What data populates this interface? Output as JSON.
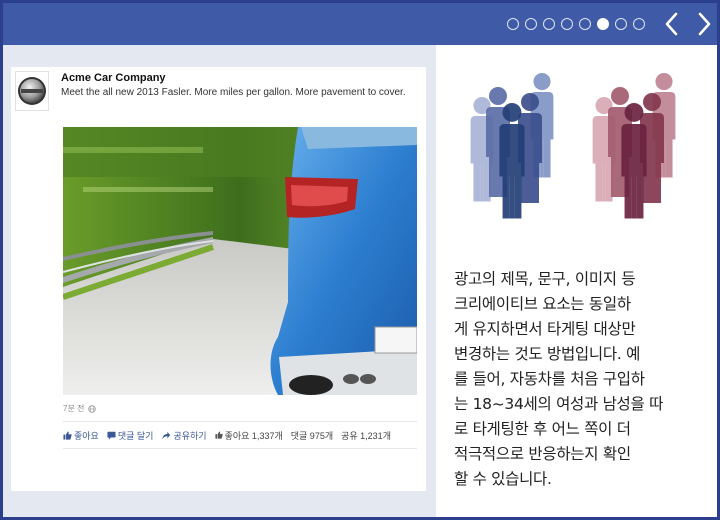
{
  "slider": {
    "total_slides": 8,
    "active_slide": 6,
    "prev_icon": "chevron-left-icon",
    "next_icon": "chevron-right-icon",
    "accent_color": "#3f5aa6"
  },
  "post": {
    "page_name": "Acme Car Company",
    "text": "Meet the all new 2013 Fasler. More miles per gallon. More pavement to cover.",
    "time": "7분 전",
    "actions": [
      {
        "label": "좋아요",
        "icon": "thumbs-up-icon"
      },
      {
        "label": "댓글 달기",
        "icon": "comment-icon"
      },
      {
        "label": "공유하기",
        "icon": "share-icon"
      }
    ],
    "stats": {
      "likes": "좋아요 1,337개",
      "comments": "댓글 975개",
      "shares": "공유 1,231개"
    }
  },
  "right": {
    "people_groups": [
      {
        "name": "blue-group",
        "colors": [
          "#a9b4d6",
          "#8194c4",
          "#5c6ea8",
          "#3c4f8f",
          "#233f78"
        ]
      },
      {
        "name": "red-group",
        "colors": [
          "#d8a9b4",
          "#c08493",
          "#a35c70",
          "#84384f",
          "#6b2340"
        ]
      }
    ],
    "text_lines": [
      "광고의 제목, 문구, 이미지 등",
      "크리에이티브 요소는 동일하",
      "게 유지하면서 타게팅 대상만",
      "변경하는 것도 방법입니다. 예",
      "를 들어, 자동차를 처음 구입하",
      "는 18~34세의 여성과 남성을 따",
      "로 타게팅한 후 어느 쪽이 더",
      "적극적으로 반응하는지 확인",
      "할 수 있습니다."
    ]
  }
}
